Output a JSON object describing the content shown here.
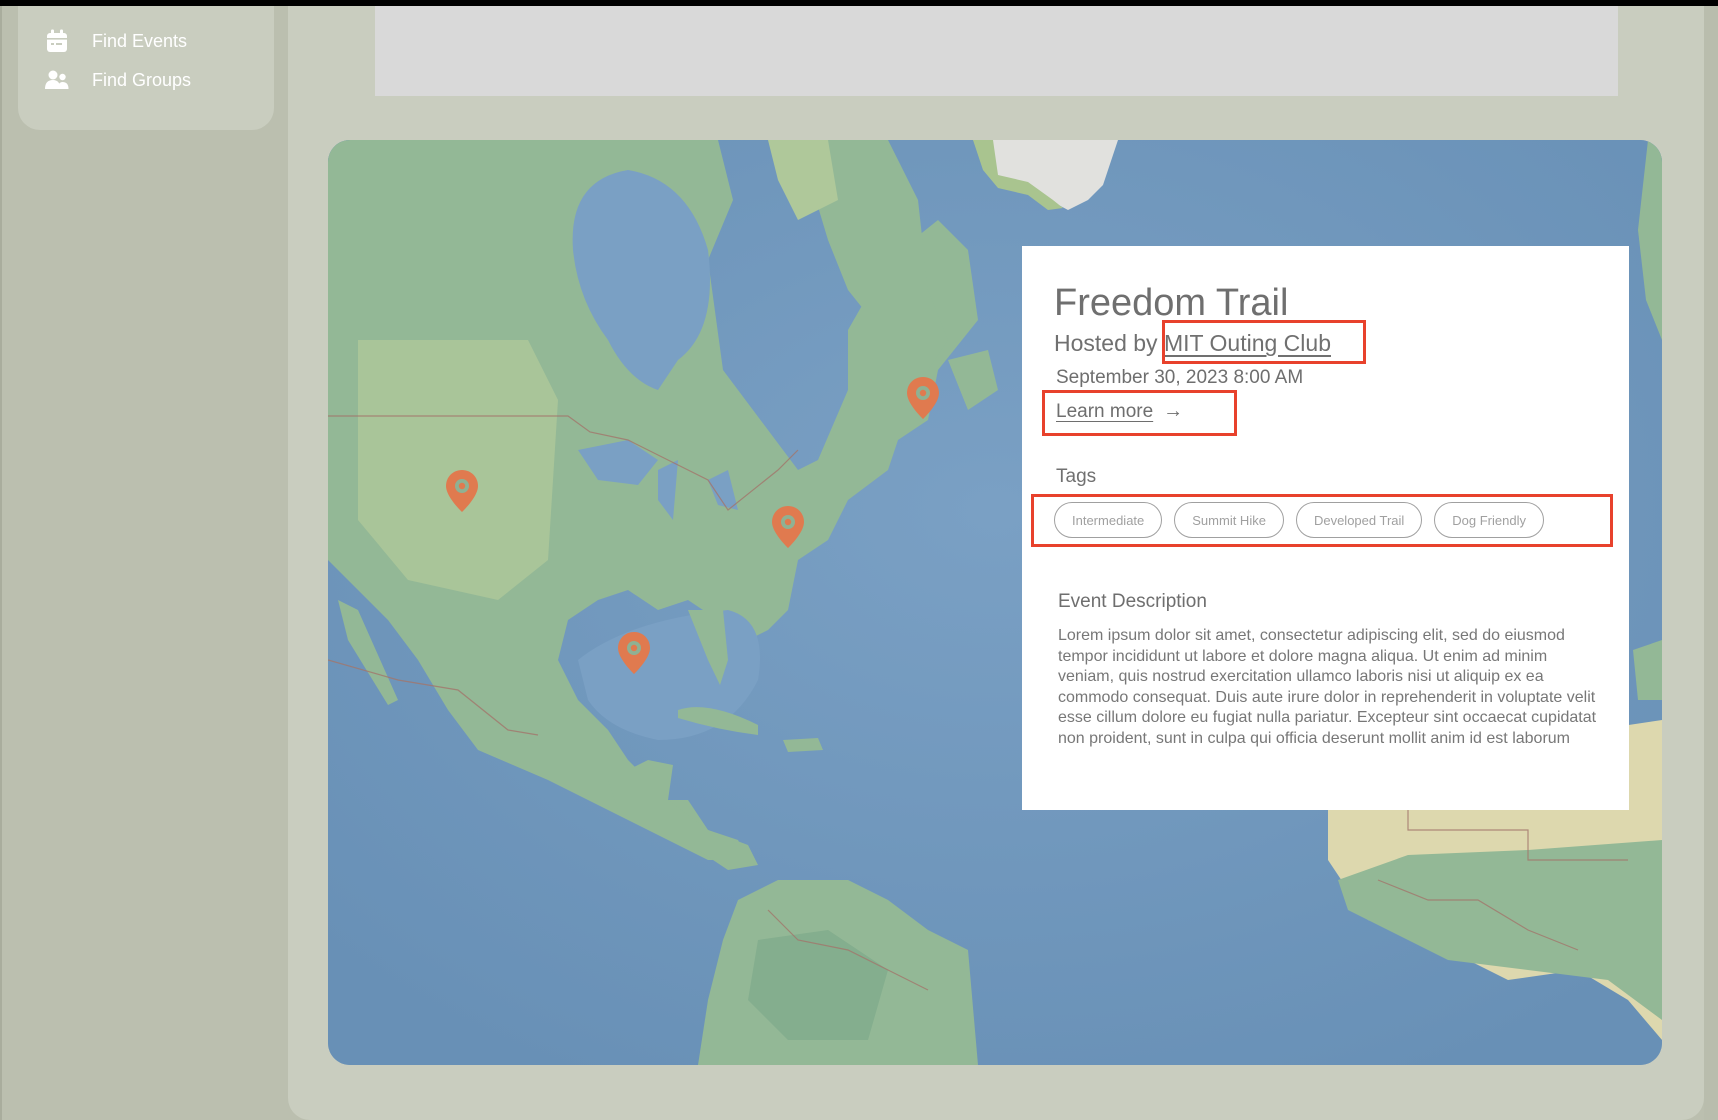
{
  "sidebar": {
    "items": [
      {
        "label": "Find Events",
        "icon": "calendar-icon"
      },
      {
        "label": "Find Groups",
        "icon": "users-icon"
      }
    ]
  },
  "colors": {
    "sidebar_bg": "#bbbfaf",
    "panel_bg": "#c9cdbf",
    "banner_bg": "#d9d9d9",
    "pin": "#e07a4f",
    "annotation": "#e8412c"
  },
  "map": {
    "markers": [
      {
        "name": "marker-montana",
        "icon": "map-pin-icon"
      },
      {
        "name": "marker-gaspe",
        "icon": "map-pin-icon"
      },
      {
        "name": "marker-new-york",
        "icon": "map-pin-icon"
      },
      {
        "name": "marker-mississippi",
        "icon": "map-pin-icon"
      }
    ]
  },
  "event": {
    "title": "Freedom Trail",
    "hosted_prefix": "Hosted by ",
    "host": "MIT Outing Club",
    "datetime": "September 30, 2023 8:00 AM",
    "learn_more": "Learn more",
    "learn_more_arrow": "→",
    "tags_label": "Tags",
    "tags": [
      "Intermediate",
      "Summit Hike",
      "Developed Trail",
      "Dog Friendly"
    ],
    "description_heading": "Event Description",
    "description": "Lorem ipsum dolor sit amet, consectetur adipiscing elit, sed do eiusmod tempor incididunt ut labore et dolore magna aliqua. Ut enim ad minim veniam, quis nostrud exercitation ullamco laboris nisi ut aliquip ex ea commodo consequat. Duis aute irure dolor in reprehenderit in voluptate velit esse cillum dolore eu fugiat nulla pariatur. Excepteur sint occaecat cupidatat non proident, sunt in culpa qui officia deserunt mollit anim id est laborum"
  }
}
